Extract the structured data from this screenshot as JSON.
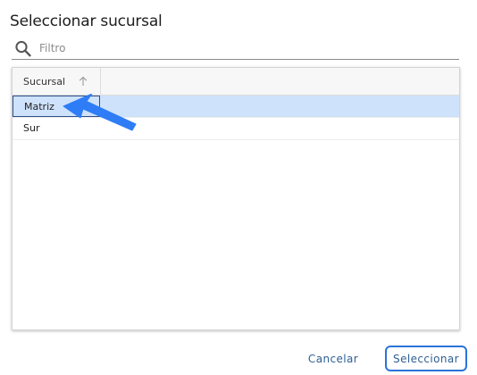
{
  "dialog": {
    "title": "Seleccionar sucursal"
  },
  "filter": {
    "icon": "search-icon",
    "placeholder": "Filtro",
    "value": ""
  },
  "grid": {
    "columns": [
      {
        "label": "Sucursal",
        "sort": "ascending",
        "sort_icon": "arrow-up-icon"
      }
    ],
    "rows": [
      {
        "sucursal": "Matriz",
        "selected": true
      },
      {
        "sucursal": "Sur",
        "selected": false
      }
    ]
  },
  "buttons": {
    "cancel_label": "Cancelar",
    "select_label": "Seleccionar"
  },
  "colors": {
    "accent": "#2a73d9",
    "selected_row": "#cfe2fb",
    "pointer": "#2f7df6"
  }
}
